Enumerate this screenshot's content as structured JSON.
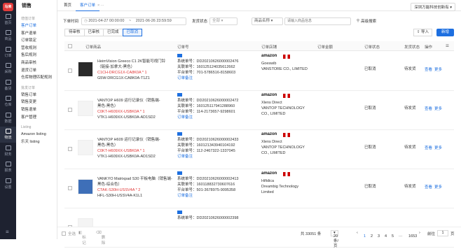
{
  "rail": {
    "logo": "马来",
    "items": [
      "首页",
      "商品",
      "订单",
      "采购",
      "备货",
      "仓库",
      "数据",
      "物流",
      "财务",
      "报表",
      "设置"
    ]
  },
  "sidebar": {
    "title": "销售",
    "group1": "增值订单",
    "items1": [
      "客户订单",
      "客户退单",
      "订单锁定",
      "营收规则",
      "售后规则",
      "商品审核",
      "退货订单",
      "仓库物理匹配规则"
    ],
    "group2": "批发订单",
    "items2": [
      "销售订单",
      "销售变更",
      "销售退单",
      "客户管理"
    ],
    "group3": "Listing",
    "items3": [
      "Amazon listing",
      "乐天 listing"
    ]
  },
  "tabs": {
    "home": "首页",
    "current": "客户订单",
    "close": "×",
    "more": "···"
  },
  "filter": {
    "time_label": "下单时间",
    "date_from": "2021-04-27 00:00:00",
    "date_sep": "~",
    "date_to": "2021-06-26 23:59:59",
    "status_label": "发货状态",
    "status_value": "全部",
    "field_select": "商品名称",
    "search_placeholder": "请输入商品信息",
    "advanced": "高级搜索",
    "shop": "深圳万能科技创新有"
  },
  "subtabs": [
    "待审核",
    "已审核",
    "已完成",
    "已取消"
  ],
  "actions": {
    "import": "导入",
    "new": "新增"
  },
  "columns": [
    "订单商品",
    "订单号",
    "订单店铺",
    "订单金额",
    "订单状态",
    "发货状态",
    "操作"
  ],
  "rows": [
    {
      "title1": "HeimVision Greeco C1 2K智能可视门铃",
      "title2": "（链接-加拿大-黑色）",
      "sku": "C1CH-DRCG1X-CA8K0A * 1",
      "sku2": "G5W-DRCG1X-CA8K0A-T1Z1",
      "orderno": "系统单号：DD20210626000002476",
      "assoc": "关联单号：160125124035612662",
      "platform": "平台单号：701-5786516-8158603",
      "note": "订单备注",
      "store_a": "Goeswib",
      "store_b": "VANSTORE CO., LIMITED",
      "amount": "",
      "status": "已取消",
      "ship": "待发货",
      "op1": "查看",
      "op2": "更多"
    },
    {
      "title1": "VANTOP H609 运行记录仪（销售端-",
      "title2": "黑色-黑色）",
      "sku": "C0KT-H609XX-USBK0A * 1",
      "sku2": "VTK1-H609XX-USBK0A-AD1SD2",
      "orderno": "系统单号：DD20210626000002472",
      "assoc": "关联单号：160125117941288960",
      "platform": "平台单号：114-2173657-9298601",
      "note": "订单备注",
      "store_a": "Xlens Direct",
      "store_b": "VANTOP TECHNOLOGY CO., LIMITED",
      "amount": "",
      "status": "已取消",
      "ship": "待发货",
      "op1": "查看",
      "op2": "更多"
    },
    {
      "title1": "VANTOP H609 运行记录仪（销售端-",
      "title2": "黑色-黑色）",
      "sku": "C0KT-H609XX-USBK0A * 1",
      "sku2": "VTK1-H609XX-USBK0A-AD1SD2",
      "orderno": "系统单号：DD20210626000002433",
      "assoc": "关联单号：160121343940104192",
      "platform": "平台单号：112-2467322-1337045",
      "note": "订单备注",
      "store_a": "Xlens Direct",
      "store_b": "VANTOP TECHNOLOGY CO., LIMITED",
      "amount": "",
      "status": "已取消",
      "ship": "待发货",
      "op1": "查看",
      "op2": "更多"
    },
    {
      "title1": "VANKYO Matrixpad S30 平板电脑（销售端-",
      "title2": "黑色-综合色）",
      "sku": "CTAK-S30H-USSV4A * 2",
      "sku2": "HFL-S30H-USSV4A-K1L1",
      "orderno": "系统单号：DD20210626000002413",
      "assoc": "关联单号：160118832730607616",
      "platform": "平台单号：501-3678975-9095358",
      "note": "订单备注",
      "store_a": "Hifidica",
      "store_b": "Dreambig Technology Limited",
      "amount": "",
      "status": "已取消",
      "ship": "待发货",
      "op1": "查看",
      "op2": "更多"
    },
    {
      "title1": "",
      "title2": "",
      "sku": "",
      "sku2": "",
      "orderno": "系统单号：DD20210626000002398",
      "assoc": "",
      "platform": "",
      "note": "",
      "store_a": "",
      "store_b": "",
      "amount": "",
      "status": "",
      "ship": "",
      "op1": "",
      "op2": ""
    }
  ],
  "footer": {
    "select_all": "全选",
    "mark": "标记",
    "delete": "删除",
    "total": "共 33051 条",
    "per_page": "20条/页",
    "pages": [
      "1",
      "2",
      "3",
      "4",
      "5",
      "···",
      "1653"
    ],
    "goto_label": "前往",
    "goto_value": "1",
    "goto_suffix": "页"
  },
  "colors": {
    "accent": "#1d6fe0",
    "red": "#e03434",
    "rail": "#1e2230"
  }
}
